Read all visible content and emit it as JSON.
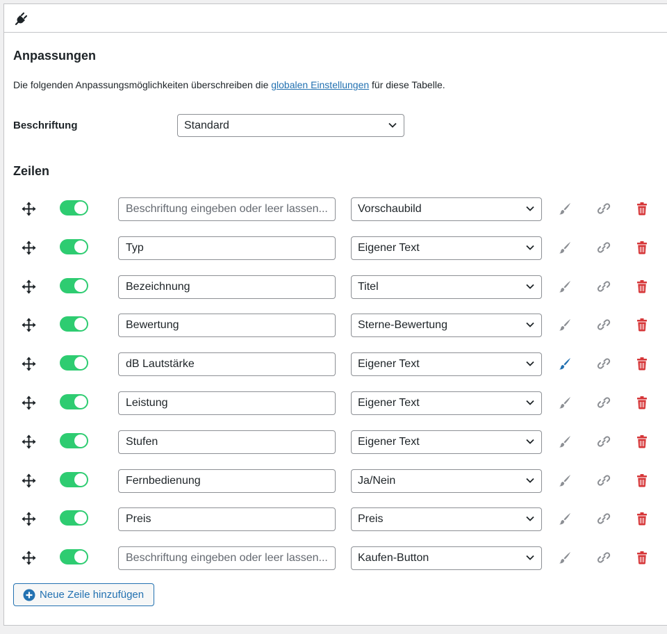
{
  "header": {
    "icon": "plug-icon"
  },
  "customizations": {
    "title": "Anpassungen",
    "description_before": "Die folgenden Anpassungsmöglichkeiten überschreiben die ",
    "description_link": "globalen Einstellungen",
    "description_after": " für diese Tabelle.",
    "caption_label": "Beschriftung",
    "caption_value": "Standard"
  },
  "rows_section": {
    "title": "Zeilen",
    "rows": [
      {
        "label": "",
        "placeholder": "Beschriftung eingeben oder leer lassen...",
        "type": "Vorschaubild",
        "enabled": true,
        "brush_active": false
      },
      {
        "label": "Typ",
        "placeholder": "",
        "type": "Eigener Text",
        "enabled": true,
        "brush_active": false
      },
      {
        "label": "Bezeichnung",
        "placeholder": "",
        "type": "Titel",
        "enabled": true,
        "brush_active": false
      },
      {
        "label": "Bewertung",
        "placeholder": "",
        "type": "Sterne-Bewertung",
        "enabled": true,
        "brush_active": false
      },
      {
        "label": "dB Lautstärke",
        "placeholder": "",
        "type": "Eigener Text",
        "enabled": true,
        "brush_active": true
      },
      {
        "label": "Leistung",
        "placeholder": "",
        "type": "Eigener Text",
        "enabled": true,
        "brush_active": false
      },
      {
        "label": "Stufen",
        "placeholder": "",
        "type": "Eigener Text",
        "enabled": true,
        "brush_active": false
      },
      {
        "label": "Fernbedienung",
        "placeholder": "",
        "type": "Ja/Nein",
        "enabled": true,
        "brush_active": false
      },
      {
        "label": "Preis",
        "placeholder": "",
        "type": "Preis",
        "enabled": true,
        "brush_active": false
      },
      {
        "label": "",
        "placeholder": "Beschriftung eingeben oder leer lassen...",
        "type": "Kaufen-Button",
        "enabled": true,
        "brush_active": false
      }
    ],
    "add_button_label": "Neue Zeile hinzufügen"
  },
  "colors": {
    "toggle_on": "#2ecc71",
    "link": "#2271b1",
    "brush_inactive": "#8c8f94",
    "brush_active": "#2271b1",
    "trash": "#d63638"
  }
}
